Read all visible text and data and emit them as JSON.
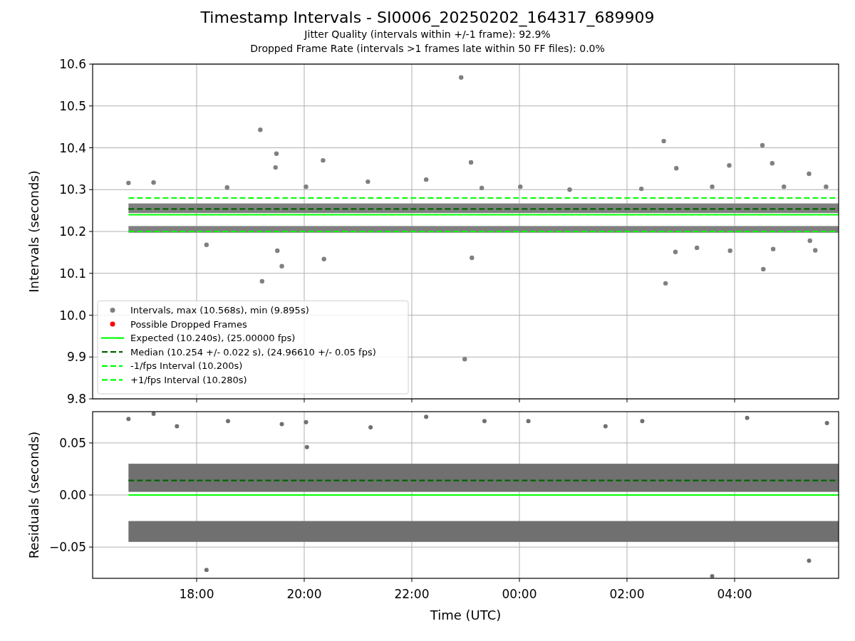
{
  "title": "Timestamp Intervals - SI0006_20250202_164317_689909",
  "subtitles": [
    "Jitter Quality (intervals within +/-1 frame): 92.9%",
    "Dropped Frame Rate (intervals >1 frames late within 50 FF files): 0.0%"
  ],
  "intervals_panel": {
    "chart_data": {
      "type": "scatter",
      "ylabel": "Intervals (seconds)",
      "grid": true,
      "legend": true,
      "xlim": [
        "2025-02-02T16:04",
        "2025-02-03T05:56"
      ],
      "ylim": [
        9.8,
        10.6
      ],
      "yticks": [
        {
          "value": 9.8,
          "label": "9.8"
        },
        {
          "value": 9.9,
          "label": "9.9"
        },
        {
          "value": 10.0,
          "label": "10.0"
        },
        {
          "value": 10.1,
          "label": "10.1"
        },
        {
          "value": 10.2,
          "label": "10.2"
        },
        {
          "value": 10.3,
          "label": "10.3"
        },
        {
          "value": 10.4,
          "label": "10.4"
        },
        {
          "value": 10.5,
          "label": "10.5"
        },
        {
          "value": 10.6,
          "label": "10.6"
        }
      ],
      "x": [
        "2025-02-02T16:44",
        "2025-02-02T17:12",
        "2025-02-02T18:11",
        "2025-02-02T18:34",
        "2025-02-02T19:11",
        "2025-02-02T19:13",
        "2025-02-02T19:28",
        "2025-02-02T19:29",
        "2025-02-02T19:30",
        "2025-02-02T19:35",
        "2025-02-02T20:02",
        "2025-02-02T20:21",
        "2025-02-02T20:22",
        "2025-02-02T21:11",
        "2025-02-02T22:16",
        "2025-02-02T22:55",
        "2025-02-02T22:59",
        "2025-02-02T23:06",
        "2025-02-02T23:07",
        "2025-02-02T23:18",
        "2025-02-03T00:01",
        "2025-02-03T00:56",
        "2025-02-03T02:16",
        "2025-02-03T02:41",
        "2025-02-03T02:43",
        "2025-02-03T02:54",
        "2025-02-03T02:55",
        "2025-02-03T03:18",
        "2025-02-03T03:35",
        "2025-02-03T03:54",
        "2025-02-03T03:55",
        "2025-02-03T04:31",
        "2025-02-03T04:32",
        "2025-02-03T04:42",
        "2025-02-03T04:43",
        "2025-02-03T04:55",
        "2025-02-03T05:23",
        "2025-02-03T05:24",
        "2025-02-03T05:30",
        "2025-02-03T05:42"
      ],
      "series": [
        {
          "name": "Intervals, max (10.568s), min (9.895s)",
          "color": "#808080",
          "marker": "circle",
          "values": [
            10.316,
            10.317,
            10.168,
            10.305,
            10.443,
            10.081,
            10.353,
            10.386,
            10.154,
            10.117,
            10.307,
            10.37,
            10.134,
            10.319,
            10.324,
            10.568,
            9.895,
            10.365,
            10.137,
            10.304,
            10.307,
            10.3,
            10.302,
            10.416,
            10.076,
            10.151,
            10.351,
            10.161,
            10.307,
            10.358,
            10.154,
            10.406,
            10.11,
            10.363,
            10.158,
            10.307,
            10.338,
            10.178,
            10.155,
            10.307
          ]
        },
        {
          "name": "Possible Dropped Frames",
          "color": "#ff0000",
          "marker": "circle",
          "values": [
            null,
            null,
            null,
            null,
            null,
            null,
            null,
            null,
            null,
            null,
            null,
            null,
            null,
            null,
            null,
            null,
            null,
            null,
            null,
            null,
            null,
            null,
            null,
            null,
            null,
            null,
            null,
            null,
            null,
            null,
            null,
            null,
            null,
            null,
            null,
            null,
            null,
            null,
            null,
            null
          ]
        }
      ],
      "bands": [
        {
          "axis": "y",
          "from": 10.244,
          "to": 10.267,
          "color": "#808080"
        },
        {
          "axis": "y",
          "from": 10.197,
          "to": 10.213,
          "color": "#808080"
        }
      ],
      "ref_lines": [
        {
          "axis": "y",
          "value": 10.24,
          "label": "Expected (10.240s), (25.00000 fps)",
          "color": "#00ff00",
          "line_style": "solid"
        },
        {
          "axis": "y",
          "value": 10.254,
          "label": "Median (10.254 +/- 0.022 s), (24.96610 +/- 0.05 fps)",
          "color": "#006400",
          "line_style": "dashed"
        },
        {
          "axis": "y",
          "value": 10.2,
          "label": "-1/fps Interval (10.200s)",
          "color": "#00ff00",
          "line_style": "dashed"
        },
        {
          "axis": "y",
          "value": 10.28,
          "label": "+1/fps Interval (10.280s)",
          "color": "#00ff00",
          "line_style": "dashed"
        }
      ]
    }
  },
  "residuals_panel": {
    "chart_data": {
      "type": "scatter",
      "ylabel": "Residuals (seconds)",
      "xlabel": "Time (UTC)",
      "grid": true,
      "xlim": [
        "2025-02-02T16:04",
        "2025-02-03T05:56"
      ],
      "ylim": [
        -0.08,
        0.08
      ],
      "yticks": [
        {
          "value": 0.05,
          "label": "0.05"
        },
        {
          "value": 0,
          "label": "0.00"
        },
        {
          "value": -0.05,
          "label": "−0.05"
        }
      ],
      "xticks": [
        {
          "value": "2025-02-02T18:00",
          "label": "18:00"
        },
        {
          "value": "2025-02-02T20:00",
          "label": "20:00"
        },
        {
          "value": "2025-02-02T22:00",
          "label": "22:00"
        },
        {
          "value": "2025-02-03T00:00",
          "label": "00:00"
        },
        {
          "value": "2025-02-03T02:00",
          "label": "02:00"
        },
        {
          "value": "2025-02-03T04:00",
          "label": "04:00"
        }
      ],
      "x": [
        "2025-02-02T16:44",
        "2025-02-02T17:12",
        "2025-02-02T17:38",
        "2025-02-02T18:11",
        "2025-02-02T18:35",
        "2025-02-02T19:35",
        "2025-02-02T20:02",
        "2025-02-02T20:03",
        "2025-02-02T21:14",
        "2025-02-02T22:16",
        "2025-02-02T23:21",
        "2025-02-03T00:10",
        "2025-02-03T01:36",
        "2025-02-03T02:17",
        "2025-02-03T03:35",
        "2025-02-03T04:14",
        "2025-02-03T05:23",
        "2025-02-03T05:43"
      ],
      "series": [
        {
          "color": "#707070",
          "marker": "circle",
          "values": [
            0.073,
            0.078,
            0.066,
            -0.072,
            0.071,
            0.068,
            0.07,
            0.046,
            0.065,
            0.075,
            0.071,
            0.071,
            0.066,
            0.071,
            -0.078,
            0.074,
            -0.063,
            0.069
          ]
        }
      ],
      "bands": [
        {
          "axis": "y",
          "from": 0.003,
          "to": 0.03,
          "color": "#707070"
        },
        {
          "axis": "y",
          "from": -0.045,
          "to": -0.025,
          "color": "#707070"
        }
      ],
      "ref_lines": [
        {
          "axis": "y",
          "value": 0,
          "color": "#00ff00",
          "line_style": "solid"
        },
        {
          "axis": "y",
          "value": 0.014,
          "color": "#006400",
          "line_style": "dashed"
        }
      ]
    }
  }
}
